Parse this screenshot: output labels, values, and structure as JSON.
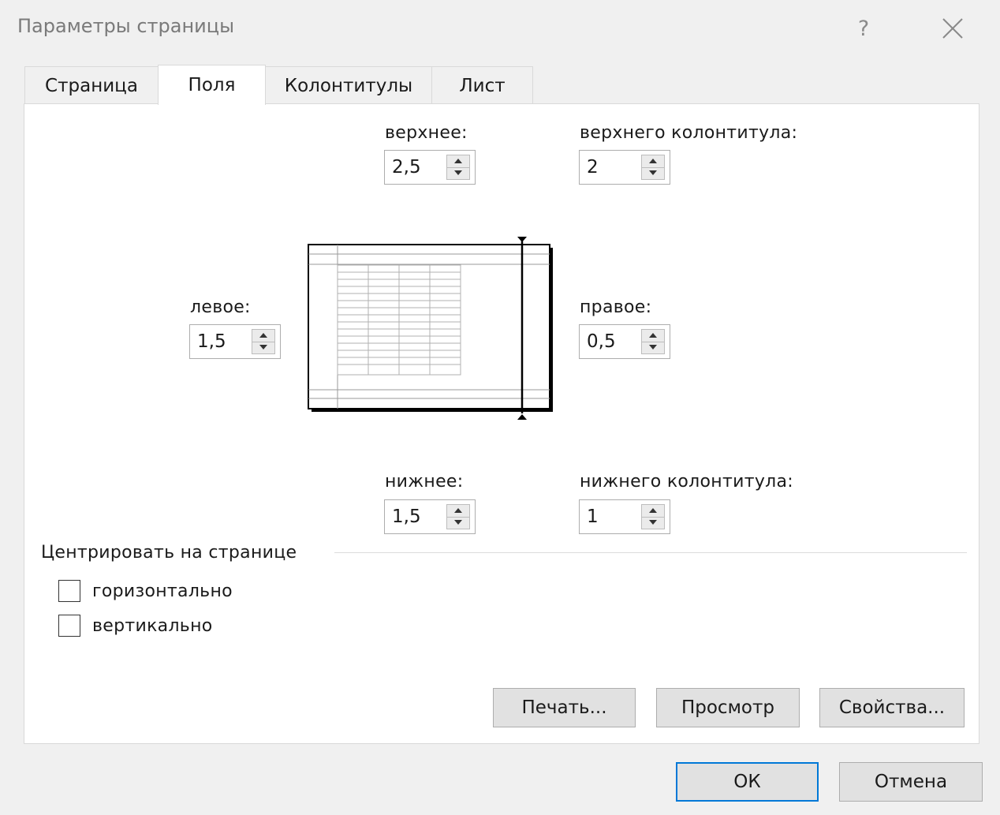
{
  "window": {
    "title": "Параметры страницы",
    "help_glyph": "?"
  },
  "tabs": [
    {
      "label": "Страница",
      "active": false
    },
    {
      "label": "Поля",
      "active": true
    },
    {
      "label": "Колонтитулы",
      "active": false
    },
    {
      "label": "Лист",
      "active": false
    }
  ],
  "margins": {
    "top": {
      "label": "верхнее:",
      "value": "2,5"
    },
    "header": {
      "label": "верхнего колонтитула:",
      "value": "2"
    },
    "left": {
      "label": "левое:",
      "value": "1,5"
    },
    "right": {
      "label": "правое:",
      "value": "0,5"
    },
    "bottom": {
      "label": "нижнее:",
      "value": "1,5"
    },
    "footer": {
      "label": "нижнего колонтитула:",
      "value": "1"
    }
  },
  "center": {
    "group_label": "Центрировать на странице",
    "horizontal": {
      "label": "горизонтально",
      "checked": false
    },
    "vertical": {
      "label": "вертикально",
      "checked": false
    }
  },
  "buttons": {
    "print": "Печать...",
    "preview": "Просмотр",
    "properties": "Свойства...",
    "ok": "ОК",
    "cancel": "Отмена"
  },
  "colors": {
    "focus_border": "#0078d7",
    "dialog_bg": "#f0f0f0",
    "panel_bg": "#ffffff"
  },
  "icons": [
    "help-icon",
    "close-icon",
    "spin-up-icon",
    "spin-down-icon"
  ]
}
